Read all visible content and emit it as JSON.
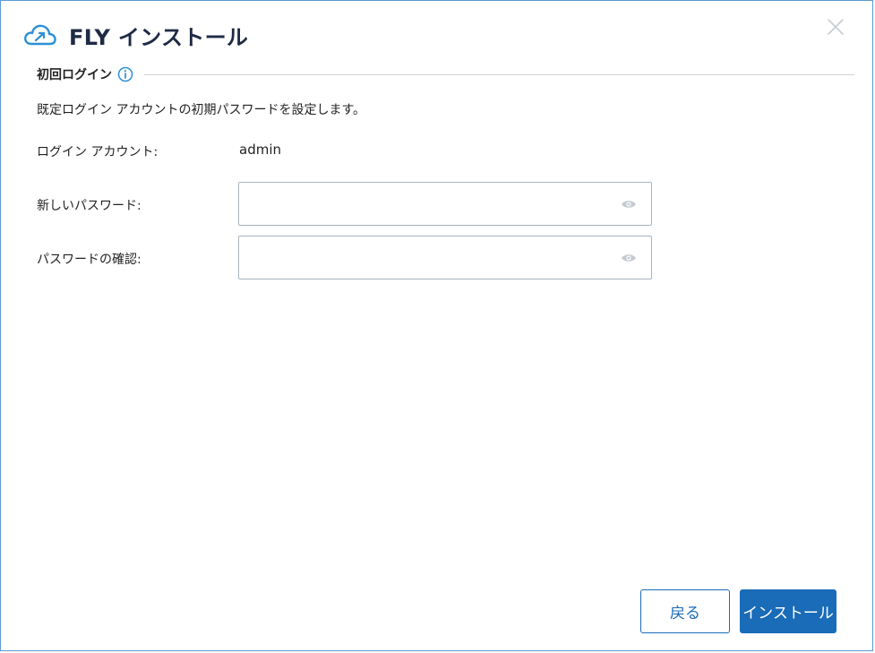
{
  "header": {
    "title": "FLY インストール",
    "logo_icon": "cloud-arrow-icon",
    "close_icon": "close-icon"
  },
  "section": {
    "title": "初回ログイン",
    "info_icon": "info-icon"
  },
  "description": "既定ログイン アカウントの初期パスワードを設定します。",
  "form": {
    "account_label": "ログイン アカウント:",
    "account_value": "admin",
    "new_password_label": "新しいパスワード:",
    "new_password_value": "",
    "confirm_password_label": "パスワードの確認:",
    "confirm_password_value": ""
  },
  "buttons": {
    "back_label": "戻る",
    "install_label": "インストール"
  },
  "colors": {
    "accent": "#1a6bb8",
    "border": "#5b9bd5",
    "title": "#1f2a44"
  }
}
